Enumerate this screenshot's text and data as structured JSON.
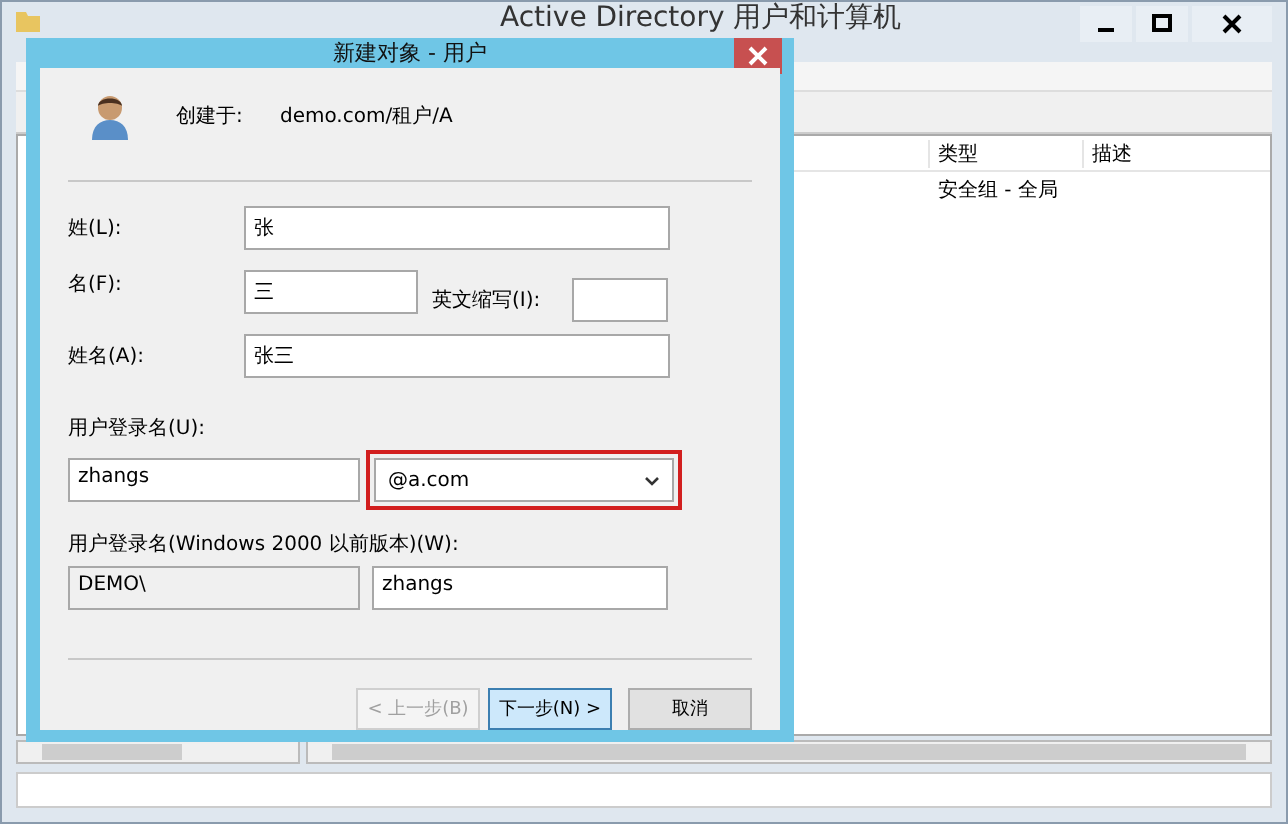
{
  "window": {
    "title": "Active Directory 用户和计算机"
  },
  "list": {
    "columns": [
      "类型",
      "描述"
    ],
    "rows": [
      {
        "type": "安全组 - 全局"
      }
    ]
  },
  "dialog": {
    "title": "新建对象 - 用户",
    "created_in_label": "创建于:",
    "created_in": "demo.com/租户/A",
    "last_name": {
      "label": "姓(L):",
      "value": "张"
    },
    "first_name": {
      "label": "名(F):",
      "value": "三"
    },
    "initials": {
      "label": "英文缩写(I):"
    },
    "full_name": {
      "label": "姓名(A):",
      "value": "张三"
    },
    "logon": {
      "label": "用户登录名(U):",
      "value": "zhangs",
      "suffix": "@a.com",
      "highlighted": true
    },
    "legacy": {
      "label": "用户登录名(Windows 2000 以前版本)(W):",
      "domain": "DEMO\\",
      "value": "zhangs"
    },
    "buttons": [
      {
        "label": "< 上一步(B)",
        "kind": "back",
        "disabled": true
      },
      {
        "label": "下一步(N) >",
        "kind": "next",
        "disabled": false
      },
      {
        "label": "取消",
        "kind": "cancel",
        "disabled": false
      }
    ]
  }
}
